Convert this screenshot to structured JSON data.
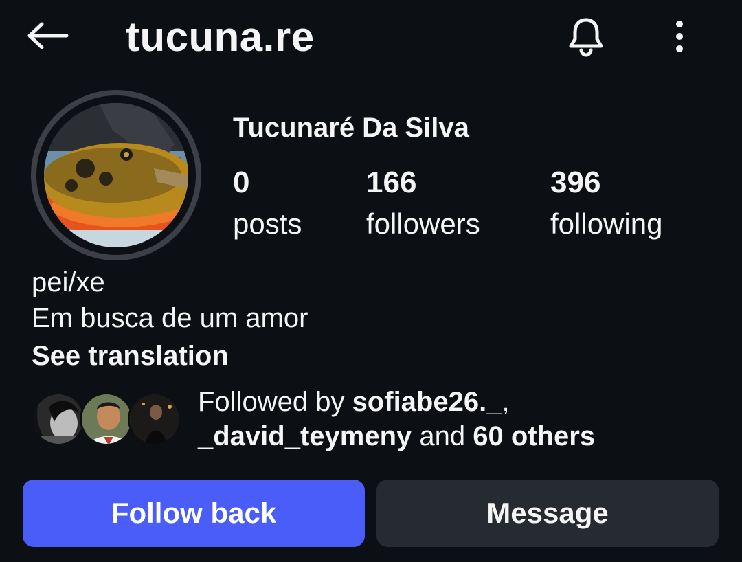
{
  "header": {
    "username": "tucuna.re",
    "back_icon": "arrow-left-icon",
    "bell_icon": "bell-icon",
    "more_icon": "more-vertical-icon"
  },
  "profile": {
    "display_name": "Tucunaré Da Silva",
    "stats": [
      {
        "value": "0",
        "label": "posts"
      },
      {
        "value": "166",
        "label": "followers"
      },
      {
        "value": "396",
        "label": "following"
      }
    ],
    "bio_lines": [
      "pei/xe",
      "Em busca de um amor"
    ],
    "see_translation": "See translation"
  },
  "followed_by": {
    "prefix": "Followed by ",
    "user1": "sofiabe26._",
    "comma": ",",
    "user2": "_david_teymeny",
    "connector": " and ",
    "others": "60 others"
  },
  "actions": {
    "follow_back": "Follow back",
    "message": "Message"
  },
  "colors": {
    "background": "#0c0f14",
    "primary_button": "#4a5df9",
    "secondary_button": "#262a31"
  }
}
